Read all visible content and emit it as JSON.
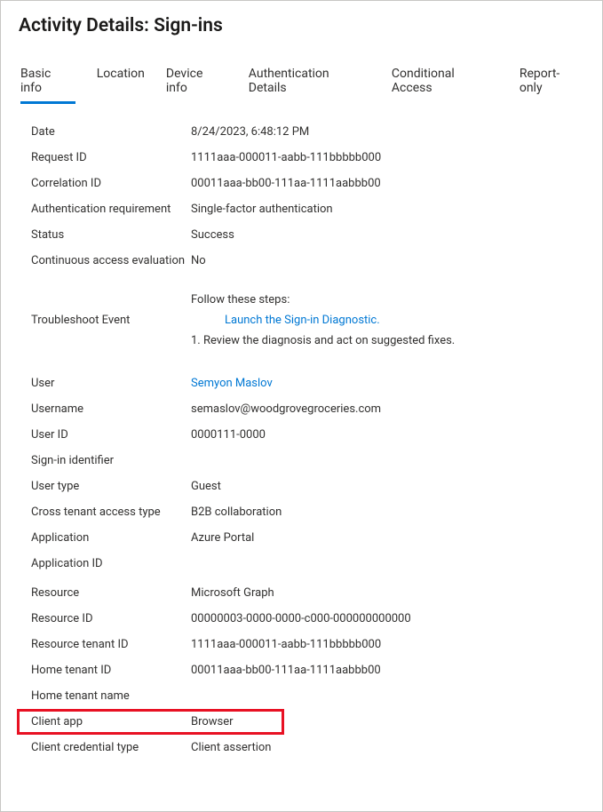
{
  "title": "Activity Details: Sign-ins",
  "tabs": {
    "basic_info": "Basic info",
    "location": "Location",
    "device_info": "Device info",
    "auth_details": "Authentication Details",
    "conditional_access": "Conditional Access",
    "report_only": "Report-only"
  },
  "labels": {
    "date": "Date",
    "request_id": "Request ID",
    "correlation_id": "Correlation ID",
    "auth_requirement": "Authentication requirement",
    "status": "Status",
    "cae": "Continuous access evaluation",
    "troubleshoot": "Troubleshoot Event",
    "user": "User",
    "username": "Username",
    "user_id": "User ID",
    "signin_identifier": "Sign-in identifier",
    "user_type": "User type",
    "cross_tenant": "Cross tenant access type",
    "application": "Application",
    "application_id": "Application ID",
    "resource": "Resource",
    "resource_id": "Resource ID",
    "resource_tenant_id": "Resource tenant ID",
    "home_tenant_id": "Home tenant ID",
    "home_tenant_name": "Home tenant name",
    "client_app": "Client app",
    "client_credential_type": "Client credential type"
  },
  "values": {
    "date": "8/24/2023, 6:48:12 PM",
    "request_id": "1111aaa-000011-aabb-111bbbbb000",
    "correlation_id": "00011aaa-bb00-111aa-1111aabbb00",
    "auth_requirement": "Single-factor authentication",
    "status": "Success",
    "cae": "No",
    "troubleshoot_lead": "Follow these steps:",
    "troubleshoot_link": "Launch the Sign-in Diagnostic.",
    "troubleshoot_step": "1. Review the diagnosis and act on suggested fixes.",
    "user": "Semyon Maslov",
    "username": "semaslov@woodgrovegroceries.com",
    "user_id": "0000111-0000",
    "signin_identifier": "",
    "user_type": "Guest",
    "cross_tenant": "B2B collaboration",
    "application": "Azure Portal",
    "application_id": "",
    "resource": "Microsoft Graph",
    "resource_id": "00000003-0000-0000-c000-000000000000",
    "resource_tenant_id": "1111aaa-000011-aabb-111bbbbb000",
    "home_tenant_id": "00011aaa-bb00-111aa-1111aabbb00",
    "home_tenant_name": "",
    "client_app": "Browser",
    "client_credential_type": "Client assertion"
  }
}
